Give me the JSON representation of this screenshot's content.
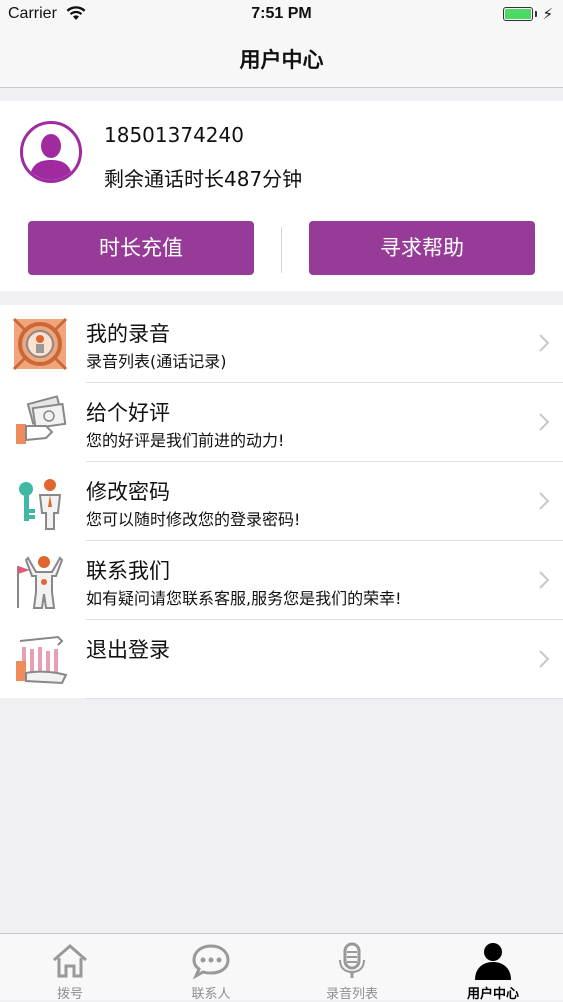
{
  "status_bar": {
    "carrier": "Carrier",
    "time": "7:51 PM"
  },
  "nav": {
    "title": "用户中心"
  },
  "profile": {
    "phone": "18501374240",
    "remaining": "剩余通话时长487分钟",
    "recharge_label": "时长充值",
    "help_label": "寻求帮助"
  },
  "menu": [
    {
      "title": "我的录音",
      "subtitle": "录音列表(通话记录)",
      "icon": "recording-icon"
    },
    {
      "title": "给个好评",
      "subtitle": "您的好评是我们前进的动力!",
      "icon": "money-hand-icon"
    },
    {
      "title": "修改密码",
      "subtitle": "您可以随时修改您的登录密码!",
      "icon": "key-person-icon"
    },
    {
      "title": "联系我们",
      "subtitle": "如有疑问请您联系客服,服务您是我们的荣幸!",
      "icon": "contact-person-icon"
    },
    {
      "title": "退出登录",
      "subtitle": "",
      "icon": "logout-icon"
    }
  ],
  "tabs": [
    {
      "label": "拨号",
      "icon": "home-icon"
    },
    {
      "label": "联系人",
      "icon": "chat-bubble-icon"
    },
    {
      "label": "录音列表",
      "icon": "microphone-icon"
    },
    {
      "label": "用户中心",
      "icon": "user-icon",
      "active": true
    }
  ],
  "colors": {
    "accent": "#963c98",
    "avatar_ring": "#a02aa0",
    "battery": "#4cd964"
  }
}
